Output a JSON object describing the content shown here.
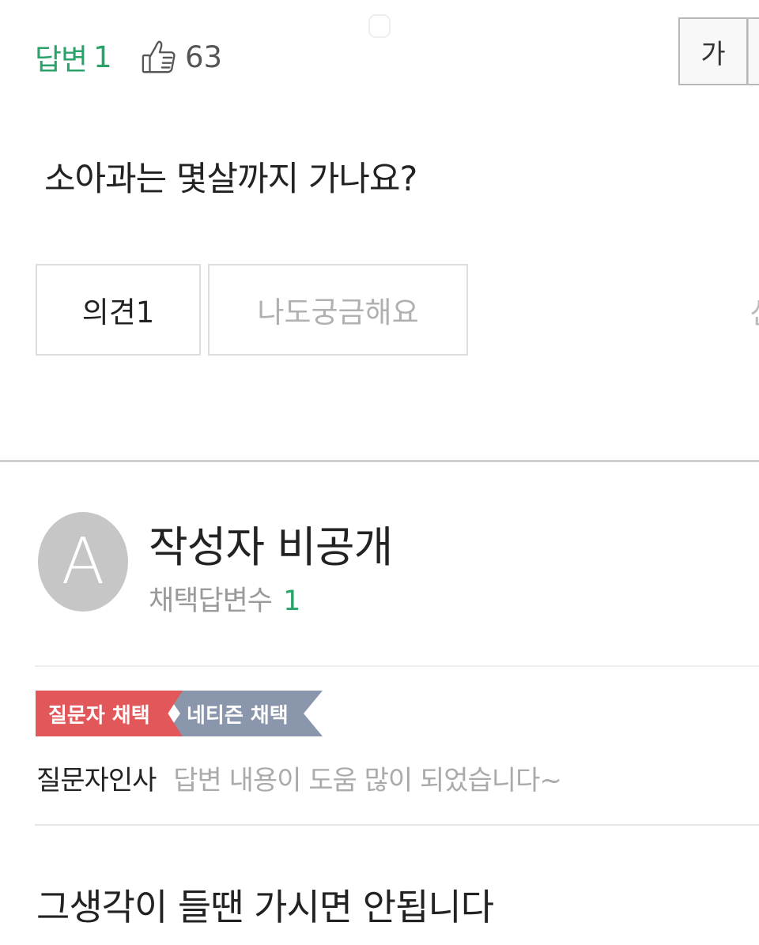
{
  "header": {
    "answer_label": "답변",
    "answer_count": "1",
    "like_count": "63",
    "font_size_button": "가"
  },
  "question": {
    "title": "소아과는 몇살까지 가나요?",
    "opinion_button": "의견1",
    "curious_button": "나도궁금해요",
    "right_cut_text": "신"
  },
  "answer": {
    "avatar_letter": "A",
    "author_name": "작성자 비공개",
    "meta_label": "채택답변수",
    "meta_count": "1",
    "badges": {
      "asker_choice": "질문자 채택",
      "netizen_choice": "네티즌 채택"
    },
    "thanks_label": "질문자인사",
    "thanks_text": "답변 내용이 도움 많이 되었습니다~",
    "body": "그생각이 들땐 가시면 안됩니다"
  },
  "icons": {
    "like": "thumbs-up-icon"
  },
  "colors": {
    "accent_green": "#2aa36b",
    "badge_red": "#e25759",
    "badge_slate": "#8a96ac"
  }
}
